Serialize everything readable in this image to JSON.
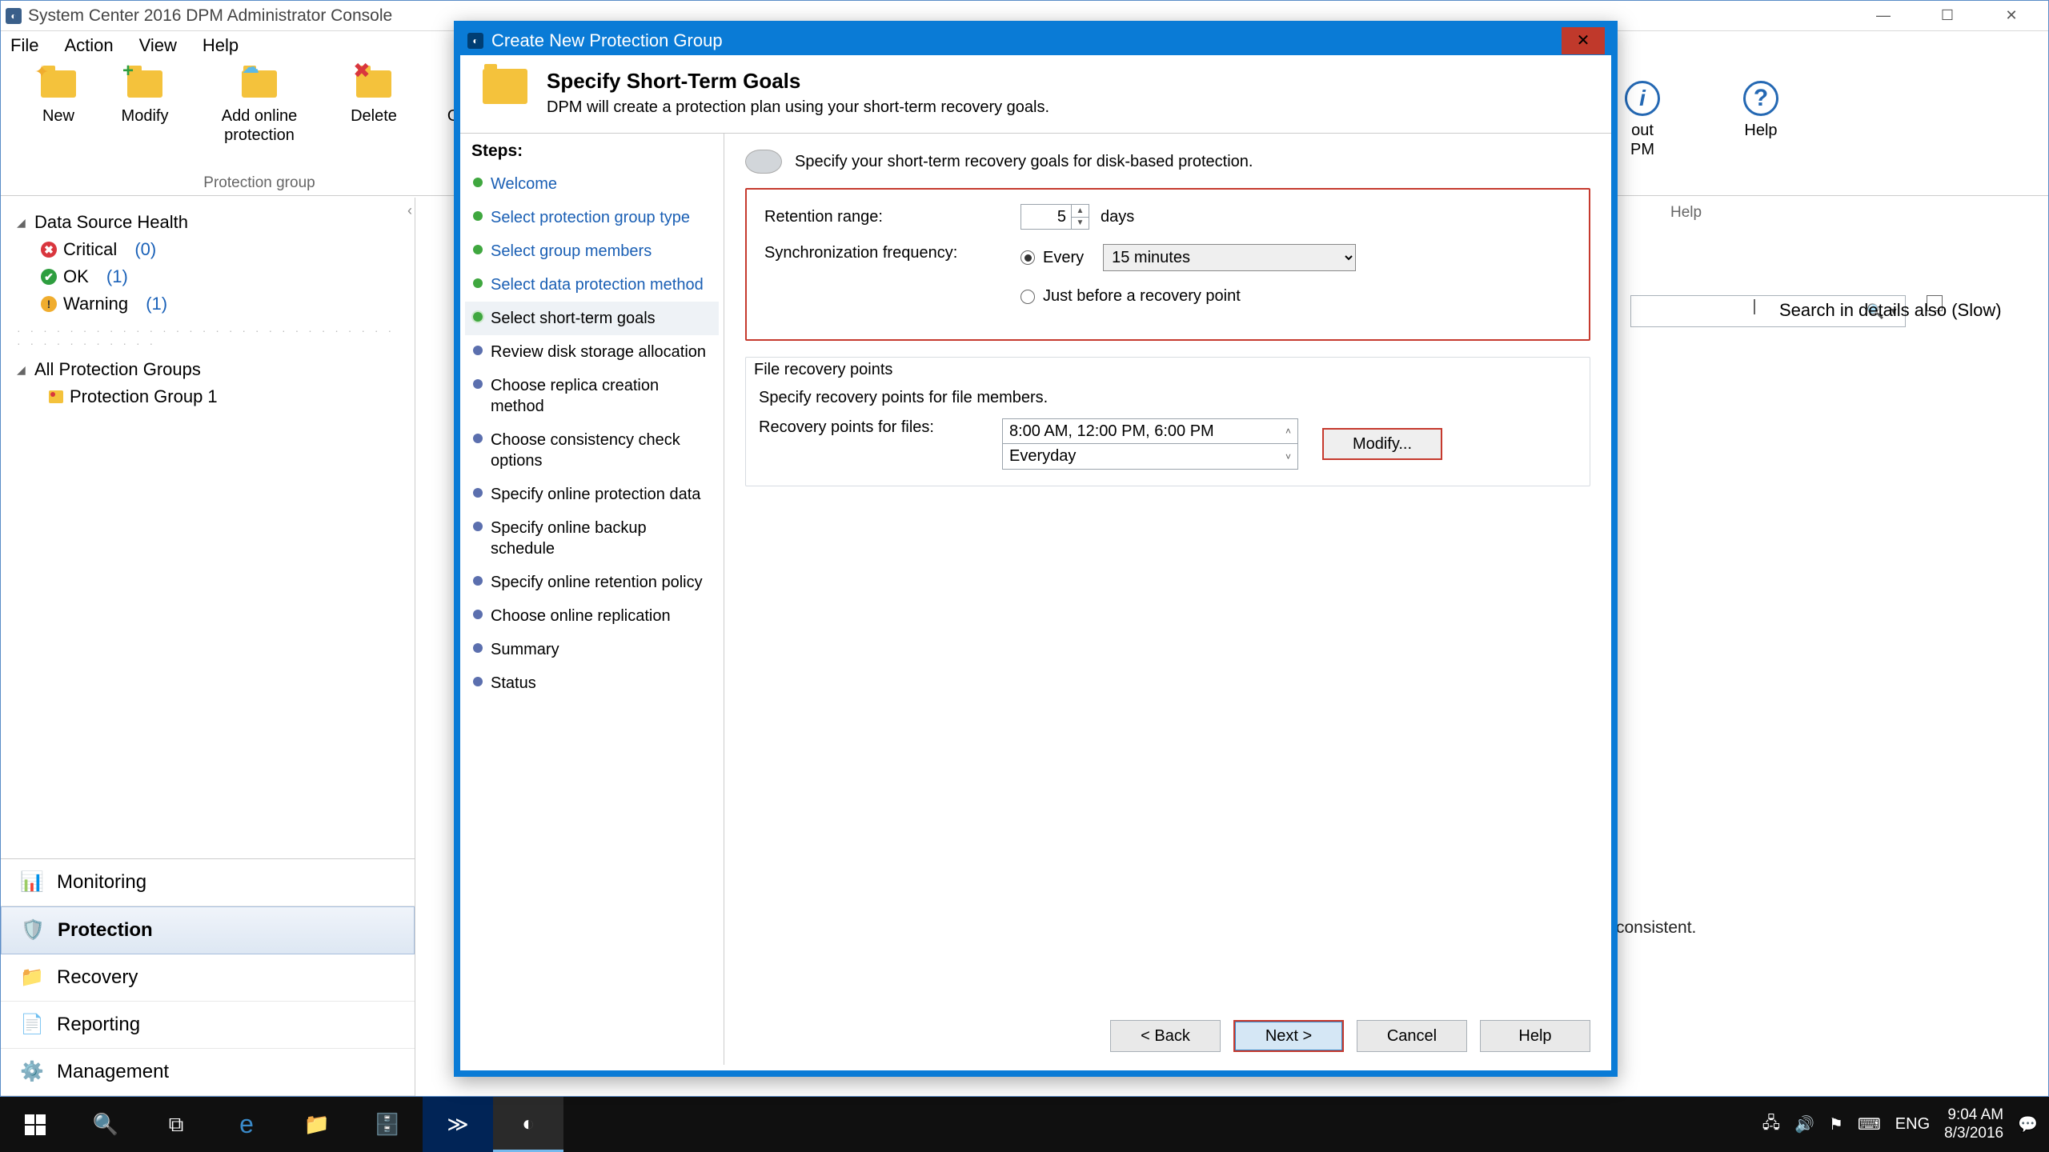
{
  "window": {
    "title": "System Center 2016 DPM Administrator Console"
  },
  "menu": {
    "file": "File",
    "action": "Action",
    "view": "View",
    "help": "Help"
  },
  "ribbon": {
    "group1_label": "Protection group",
    "new": "New",
    "modify": "Modify",
    "add_online": "Add online protection",
    "delete": "Delete",
    "options": "Opt",
    "about_partial": "out",
    "pm_partial": "PM",
    "help": "Help",
    "help_group": "Help"
  },
  "sidebar": {
    "health_header": "Data Source Health",
    "critical_label": "Critical",
    "critical_count": "(0)",
    "ok_label": "OK",
    "ok_count": "(1)",
    "warning_label": "Warning",
    "warning_count": "(1)",
    "groups_header": "All Protection Groups",
    "group1": "Protection Group 1",
    "nav": {
      "monitoring": "Monitoring",
      "protection": "Protection",
      "recovery": "Recovery",
      "reporting": "Reporting",
      "management": "Management"
    }
  },
  "behind": {
    "consistent": "consistent."
  },
  "search": {
    "details_label": "Search in details also (Slow)"
  },
  "dialog": {
    "title": "Create New Protection Group",
    "header_title": "Specify Short-Term Goals",
    "header_sub": "DPM will create a protection plan using your short-term recovery goals.",
    "steps_label": "Steps:",
    "steps": {
      "welcome": "Welcome",
      "select_type": "Select protection group type",
      "select_members": "Select group members",
      "select_method": "Select data protection method",
      "short_term": "Select short-term goals",
      "review_disk": "Review disk storage allocation",
      "replica": "Choose replica creation method",
      "consistency": "Choose consistency check options",
      "online_data": "Specify online protection data",
      "online_backup": "Specify online backup schedule",
      "online_retention": "Specify online retention policy",
      "online_repl": "Choose online replication",
      "summary": "Summary",
      "status": "Status"
    },
    "instruction": "Specify your short-term recovery goals for disk-based protection.",
    "retention_label": "Retention range:",
    "retention_value": "5",
    "retention_unit": "days",
    "sync_label": "Synchronization frequency:",
    "sync_every": "Every",
    "sync_value": "15 minutes",
    "sync_just_before": "Just before a recovery point",
    "frp_title": "File recovery points",
    "frp_desc": "Specify recovery points for file members.",
    "rp_label": "Recovery points for files:",
    "rp_times": "8:00 AM, 12:00 PM, 6:00 PM",
    "rp_sched": "Everyday",
    "modify": "Modify...",
    "back": "< Back",
    "next": "Next >",
    "cancel": "Cancel",
    "help": "Help"
  },
  "taskbar": {
    "lang": "ENG",
    "time": "9:04 AM",
    "date": "8/3/2016"
  }
}
